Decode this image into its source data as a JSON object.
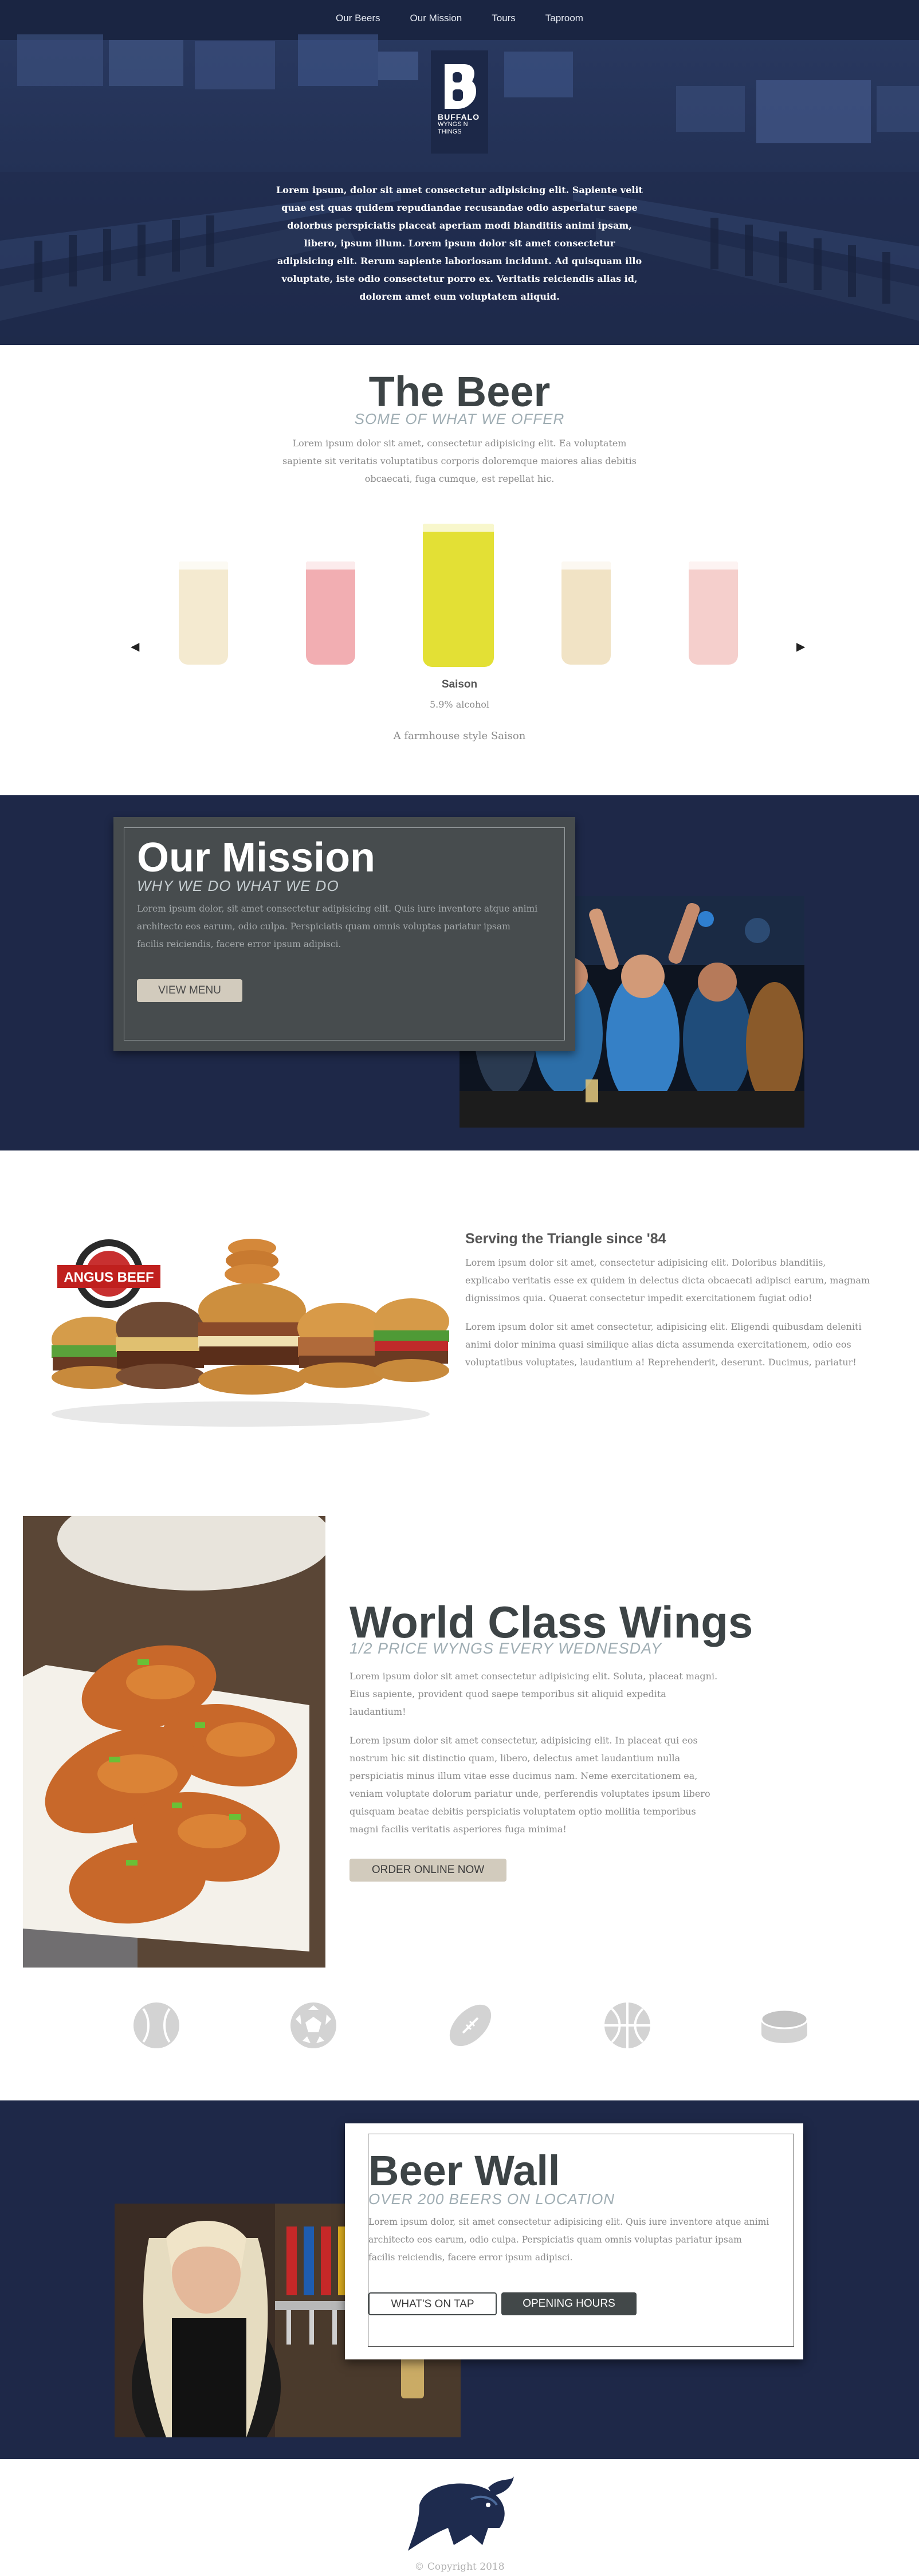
{
  "nav": {
    "items": [
      "Our Beers",
      "Our Mission",
      "Tours",
      "Taproom"
    ]
  },
  "logo": {
    "name": "BUFFALO",
    "tagline_1": "WYNGS N",
    "tagline_2": "THINGS"
  },
  "hero": {
    "text": "Lorem ipsum, dolor sit amet consectetur adipisicing elit. Sapiente velit quae est quas quidem repudiandae recusandae odio asperiatur saepe dolorbus perspiciatis placeat aperiam modi blanditiis animi ipsam, libero, ipsum illum. Lorem ipsum dolor sit amet consectetur adipisicing elit. Rerum sapiente laboriosam incidunt. Ad quisquam illo voluptate, iste odio consectetur porro ex. Veritatis reiciendis alias id, dolorem amet eum voluptatem aliquid."
  },
  "beer": {
    "title": "The Beer",
    "subtitle": "SOME OF WHAT WE OFFER",
    "description": "Lorem ipsum dolor sit amet, consectetur adipisicing elit. Ea voluptatem sapiente sit veritatis voluptatibus corporis doloremque maiores alias debitis obcaecati, fuga cumque, est repellat hic.",
    "selected": {
      "name": "Saison",
      "abv": "5.9% alcohol",
      "style": "A farmhouse style Saison"
    },
    "arrow_prev": "◀",
    "arrow_next": "▶",
    "glass_colors": [
      "#f4ead0",
      "#f2aeb2",
      "#e3e035",
      "#f1e3c5",
      "#f5cfcc"
    ]
  },
  "mission": {
    "title": "Our Mission",
    "subtitle": "WHY WE DO WHAT WE DO",
    "text": "Lorem ipsum dolor, sit amet consectetur adipisicing elit. Quis iure inventore atque animi architecto eos earum, odio culpa. Perspiciatis quam omnis voluptas pariatur ipsam facilis reiciendis, facere error ipsum adipisci.",
    "button": "VIEW MENU"
  },
  "burgers": {
    "badge_text": "ANGUS BEEF",
    "heading": "Serving the Triangle since '84",
    "p1": "Lorem ipsum dolor sit amet, consectetur adipisicing elit. Doloribus blanditiis, explicabo veritatis esse ex quidem in delectus dicta obcaecati adipisci earum, magnam dignissimos quia. Quaerat consectetur impedit exercitationem fugiat odio!",
    "p2": "Lorem ipsum dolor sit amet consectetur, adipisicing elit. Eligendi quibusdam deleniti animi dolor minima quasi similique alias dicta assumenda exercitationem, odio eos voluptatibus voluptates, laudantium a! Reprehenderit, deserunt. Ducimus, pariatur!"
  },
  "wings": {
    "title": "World Class Wings",
    "subtitle": "1/2 PRICE WYNGS EVERY WEDNESDAY",
    "p1": "Lorem ipsum dolor sit amet consectetur adipisicing elit. Soluta, placeat magni. Eius sapiente, provident quod saepe temporibus sit aliquid expedita laudantium!",
    "p2": "Lorem ipsum dolor sit amet consectetur, adipisicing elit. In placeat qui eos nostrum hic sit distinctio quam, libero, delectus amet laudantium nulla perspiciatis minus illum vitae esse ducimus nam. Neme exercitationem ea, veniam voluptate dolorum pariatur unde, perferendis voluptates ipsum libero quisquam beatae debitis perspiciatis voluptatem optio mollitia temporibus magni facilis veritatis asperiores fuga minima!",
    "button": "ORDER ONLINE NOW"
  },
  "sports": [
    "baseball-icon",
    "soccer-ball-icon",
    "football-icon",
    "basketball-icon",
    "hockey-puck-icon"
  ],
  "beerwall": {
    "title": "Beer Wall",
    "subtitle": "OVER 200 BEERS ON LOCATION",
    "text": "Lorem ipsum dolor, sit amet consectetur adipisicing elit. Quis iure inventore atque animi architecto eos earum, odio culpa. Perspiciatis quam omnis voluptas pariatur ipsam facilis reiciendis, facere error ipsum adipisci.",
    "button_tap": "WHAT'S ON TAP",
    "button_hours": "OPENING HOURS"
  },
  "footer": {
    "copyright": "© Copyright 2018"
  },
  "colors": {
    "navy": "#1e2848",
    "heading": "#3d4446",
    "subheading": "#9fadb3",
    "button_tan": "#d2cbbd",
    "button_dark": "#424849",
    "card_gray": "#474c4e"
  }
}
